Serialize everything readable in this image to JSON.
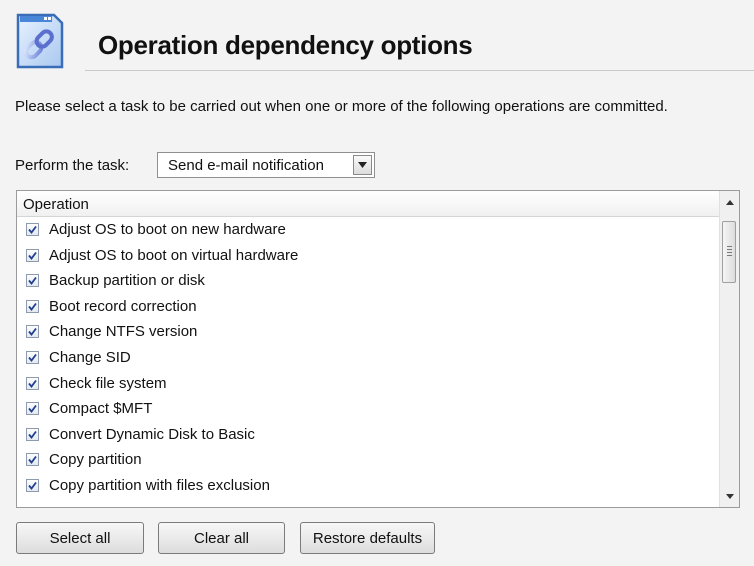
{
  "header": {
    "title": "Operation dependency options",
    "icon": "document-chain-icon"
  },
  "description": "Please select a task to be carried out when one or more of the following operations are committed.",
  "task": {
    "label": "Perform the task:",
    "selected": "Send e-mail notification"
  },
  "list": {
    "column_header": "Operation",
    "items": [
      {
        "label": "Adjust OS to boot on new hardware",
        "checked": true
      },
      {
        "label": "Adjust OS to boot on virtual hardware",
        "checked": true
      },
      {
        "label": "Backup partition or disk",
        "checked": true
      },
      {
        "label": "Boot record correction",
        "checked": true
      },
      {
        "label": "Change NTFS version",
        "checked": true
      },
      {
        "label": "Change SID",
        "checked": true
      },
      {
        "label": "Check file system",
        "checked": true
      },
      {
        "label": "Compact $MFT",
        "checked": true
      },
      {
        "label": "Convert Dynamic Disk to Basic",
        "checked": true
      },
      {
        "label": "Copy partition",
        "checked": true
      },
      {
        "label": "Copy partition with files exclusion",
        "checked": true
      }
    ]
  },
  "buttons": {
    "select_all": "Select all",
    "clear_all": "Clear all",
    "restore_defaults": "Restore defaults"
  },
  "colors": {
    "background": "#f3f3f3",
    "checkmark": "#1f3f8f",
    "border": "#9b9b9b"
  }
}
